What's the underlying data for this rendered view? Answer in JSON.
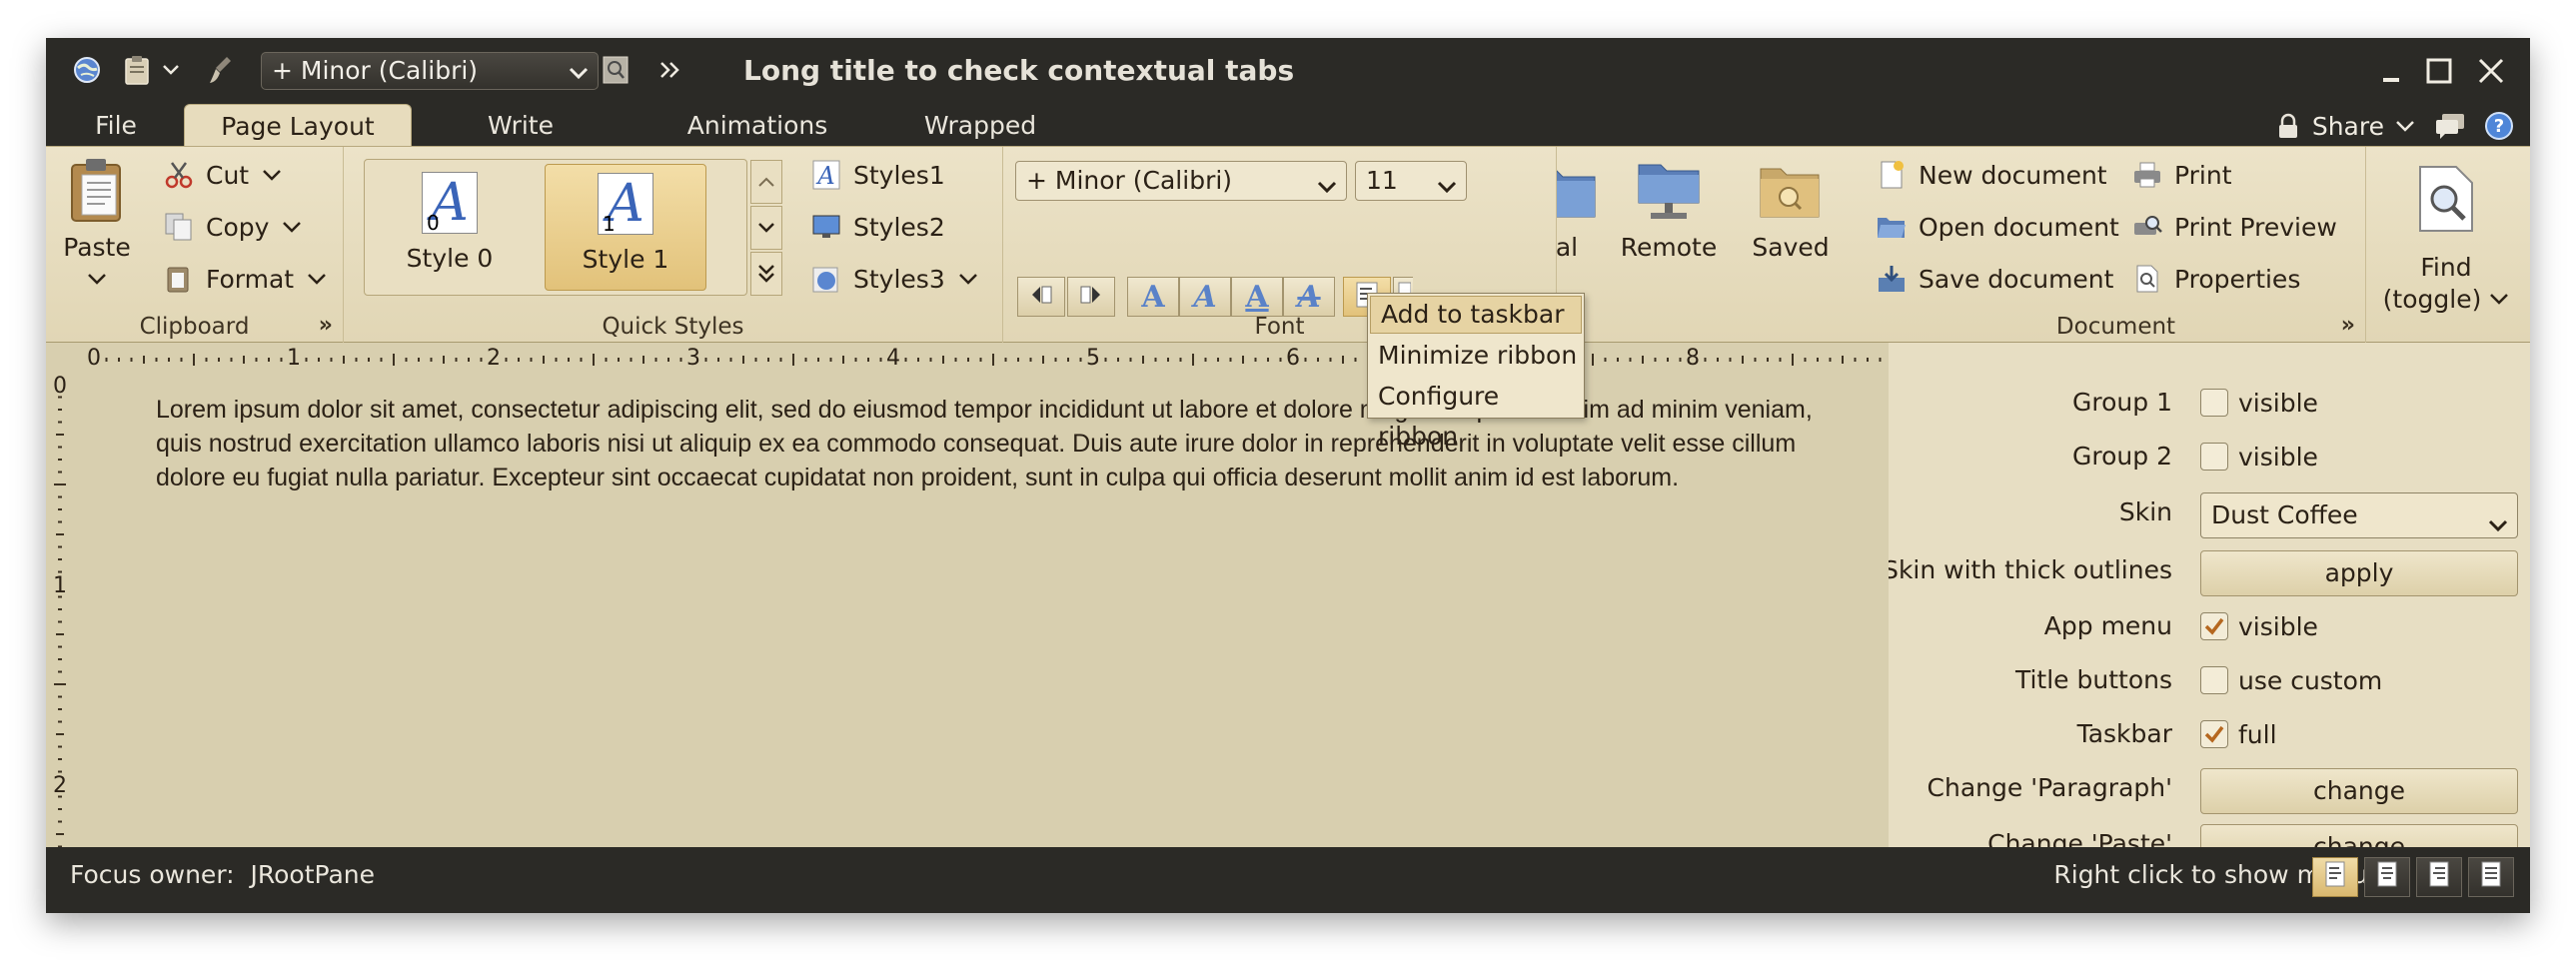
{
  "titlebar": {
    "font_combo": "+ Minor (Calibri)",
    "title": "Long title to check contextual tabs"
  },
  "tabs": {
    "file": "File",
    "page_layout": "Page Layout",
    "write": "Write",
    "animations": "Animations",
    "wrapped": "Wrapped"
  },
  "tabrow": {
    "share": "Share"
  },
  "clipboard": {
    "paste": "Paste",
    "cut": "Cut",
    "copy": "Copy",
    "format": "Format",
    "title": "Clipboard"
  },
  "quick_styles": {
    "style0": "Style 0",
    "style0_num": "0",
    "style1": "Style 1",
    "style1_num": "1",
    "styles1": "Styles1",
    "styles2": "Styles2",
    "styles3": "Styles3",
    "title": "Quick Styles",
    "glyph": "A"
  },
  "font": {
    "family": "+ Minor (Calibri)",
    "size": "11",
    "title": "Font"
  },
  "popup": {
    "add_to_taskbar": "Add to taskbar",
    "minimize_ribbon": "Minimize ribbon",
    "configure_ribbon": "Configure ribbon"
  },
  "locations": {
    "local_partial": "al",
    "remote": "Remote",
    "saved": "Saved"
  },
  "document": {
    "new": "New document",
    "open": "Open document",
    "save": "Save document",
    "print": "Print",
    "print_preview": "Print Preview",
    "properties": "Properties",
    "title": "Document"
  },
  "find": {
    "line1": "Find",
    "line2": "(toggle)"
  },
  "ruler": {
    "h": [
      "0",
      "1",
      "2",
      "3",
      "4",
      "5",
      "6",
      "7",
      "8"
    ],
    "v": [
      "0",
      "1",
      "2"
    ]
  },
  "doc_text": "Lorem ipsum dolor sit amet, consectetur adipiscing elit, sed do eiusmod tempor incididunt ut labore et dolore magna aliqua. Ut enim ad minim veniam, quis nostrud exercitation ullamco laboris nisi ut aliquip ex ea commodo consequat. Duis aute irure dolor in reprehenderit in voluptate velit esse cillum dolore eu fugiat nulla pariatur. Excepteur sint occaecat cupidatat non proident, sunt in culpa qui officia deserunt mollit anim id est laborum.",
  "panel": {
    "group1": {
      "label": "Group 1",
      "text": "visible",
      "checked": false
    },
    "group2": {
      "label": "Group 2",
      "text": "visible",
      "checked": false
    },
    "skin": {
      "label": "Skin",
      "value": "Dust Coffee"
    },
    "thick": {
      "label": "Skin with thick outlines",
      "button": "apply"
    },
    "app_menu": {
      "label": "App menu",
      "text": "visible",
      "checked": true
    },
    "title_buttons": {
      "label": "Title buttons",
      "text": "use custom",
      "checked": false
    },
    "taskbar": {
      "label": "Taskbar",
      "text": "full",
      "checked": true
    },
    "paragraph": {
      "label": "Change 'Paragraph'",
      "button": "change"
    },
    "paste": {
      "label": "Change 'Paste'",
      "button": "change"
    }
  },
  "status": {
    "focus_label": "Focus owner:",
    "focus_value": "JRootPane",
    "hint": "Right click to show menu"
  },
  "colors": {
    "frame": "#2b2a26",
    "ribbon": "#e7dcbd",
    "content": "#d8cfaf",
    "panel": "#e7dec3",
    "accent": "#e2c27a",
    "check": "#b5671f"
  }
}
